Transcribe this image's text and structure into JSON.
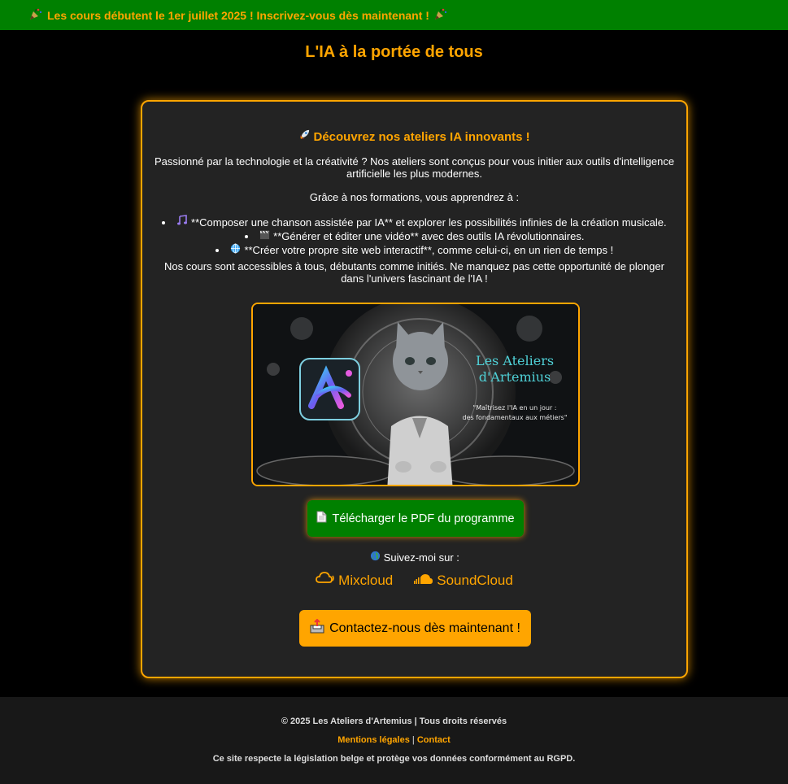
{
  "banner": {
    "text": "Les cours débutent le 1er juillet 2025 ! Inscrivez-vous dès maintenant !",
    "icon": "party-popper-icon"
  },
  "site": {
    "title": "L'IA à la portée de tous"
  },
  "card": {
    "heading": "Découvrez nos ateliers IA innovants !",
    "heading_icon": "rocket-icon",
    "intro": "Passionné par la technologie et la créativité ? Nos ateliers sont conçus pour vous initier aux outils d'intelligence artificielle les plus modernes.",
    "learn_intro": "Grâce à nos formations, vous apprendrez à :",
    "features": [
      {
        "icon": "music-note-icon",
        "text": "**Composer une chanson assistée par IA** et explorer les possibilités infinies de la création musicale."
      },
      {
        "icon": "clapperboard-icon",
        "text": "**Générer et éditer une vidéo** avec des outils IA révolutionnaires."
      },
      {
        "icon": "globe-icon",
        "text": "**Créer votre propre site web interactif**, comme celui-ci, en un rien de temps !"
      }
    ],
    "outro": "Nos cours sont accessibles à tous, débutants comme initiés. Ne manquez pas cette opportunité de plonger dans l'univers fascinant de l'IA !"
  },
  "hero": {
    "brand_line1": "Les Ateliers",
    "brand_line2": "d'Artemius",
    "tagline_line1": "\"Maîtrisez l'IA en un jour :",
    "tagline_line2": "des fondamentaux aux métiers\"",
    "logo_text": "Ai"
  },
  "actions": {
    "pdf_label": "Télécharger le PDF du programme",
    "pdf_icon": "document-icon",
    "follow_label": "Suivez-moi sur :",
    "follow_icon": "earth-globe-icon",
    "socials": [
      {
        "name": "Mixcloud",
        "icon": "mixcloud-icon"
      },
      {
        "name": "SoundCloud",
        "icon": "soundcloud-icon"
      }
    ],
    "contact_label": "Contactez-nous dès maintenant !",
    "contact_icon": "outbox-tray-icon"
  },
  "footer": {
    "copyright": "© 2025 Les Ateliers d'Artemius | Tous droits réservés",
    "legal_link": "Mentions légales",
    "separator": "|",
    "contact_link": "Contact",
    "rgpd": "Ce site respecte la législation belge et protège vos données conformément au RGPD."
  },
  "colors": {
    "accent": "#ffa500",
    "banner_bg": "#008000",
    "card_bg": "#232323",
    "pdf_button": "#008000"
  }
}
